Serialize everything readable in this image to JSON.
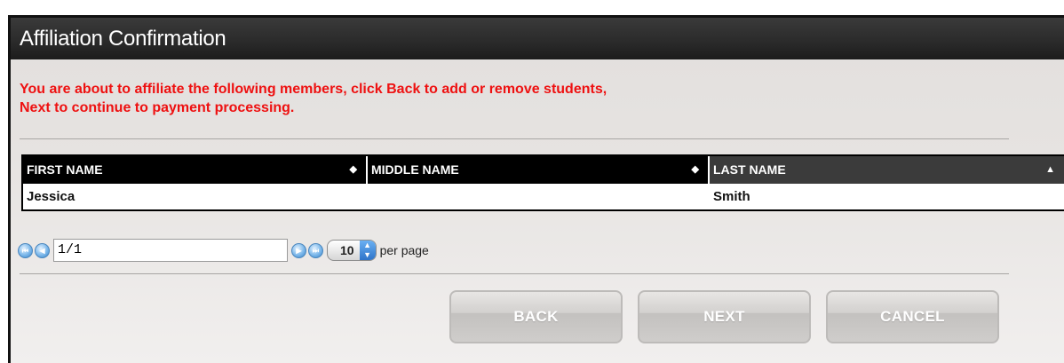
{
  "dialog": {
    "title": "Affiliation Confirmation",
    "notice_line1": "You are about to affiliate the following members, click Back to add or remove students,",
    "notice_line2": "Next to continue to payment processing."
  },
  "table": {
    "columns": [
      {
        "label": "FIRST NAME",
        "sort_icon": "sort-both-icon"
      },
      {
        "label": "MIDDLE NAME",
        "sort_icon": "sort-both-icon"
      },
      {
        "label": "LAST NAME",
        "sort_icon": "sort-ascending-icon",
        "active": true
      }
    ],
    "rows": [
      {
        "first": "Jessica",
        "middle": "",
        "last": "Smith"
      }
    ]
  },
  "pager": {
    "page_value": "1/1",
    "per_page_value": "10",
    "per_page_label": "per page"
  },
  "buttons": {
    "back": "BACK",
    "next": "NEXT",
    "cancel": "CANCEL"
  },
  "colors": {
    "notice": "#ee1111",
    "header_bg": "#000000",
    "pager_button": "#3a84c9"
  }
}
